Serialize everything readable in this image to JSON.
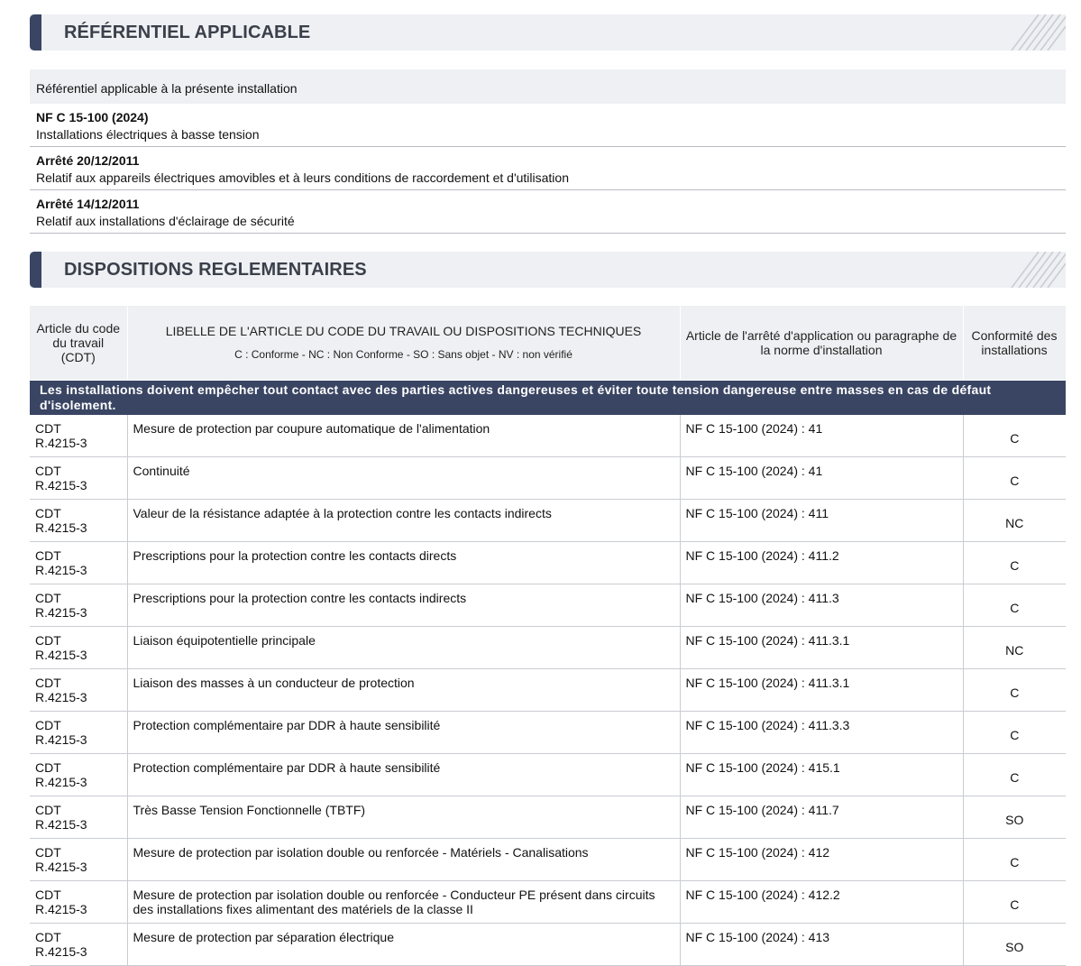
{
  "sections": {
    "referentiel_title": "RÉFÉRENTIEL APPLICABLE",
    "dispositions_title": "DISPOSITIONS REGLEMENTAIRES"
  },
  "referentiel": {
    "intro": "Référentiel applicable à la présente installation",
    "items": [
      {
        "title": "NF C 15-100 (2024)",
        "desc": "Installations électriques à basse tension"
      },
      {
        "title": "Arrêté 20/12/2011",
        "desc": "Relatif aux appareils électriques amovibles et à leurs conditions de raccordement et d'utilisation"
      },
      {
        "title": "Arrêté 14/12/2011",
        "desc": "Relatif aux installations d'éclairage de sécurité"
      }
    ]
  },
  "table": {
    "headers": {
      "article": "Article du code du travail (CDT)",
      "libelle": "LIBELLE DE L'ARTICLE DU CODE DU TRAVAIL OU DISPOSITIONS TECHNIQUES",
      "legend": "C : Conforme - NC : Non Conforme - SO : Sans objet - NV : non vérifié",
      "arrete": "Article de l'arrêté d'application ou paragraphe de la norme d'installation",
      "conformite": "Conformité des installations"
    },
    "group_title": "Les installations doivent empêcher tout contact avec des parties actives dangereuses et éviter toute tension dangereuse entre masses en cas de défaut d'isolement.",
    "rows": [
      {
        "cdt1": "CDT",
        "cdt2": "R.4215-3",
        "libelle": "Mesure de protection par coupure automatique de l'alimentation",
        "norme": "NF C 15-100 (2024) : 41",
        "conf": "C"
      },
      {
        "cdt1": "CDT",
        "cdt2": "R.4215-3",
        "libelle": "Continuité",
        "norme": "NF C 15-100 (2024) : 41",
        "conf": "C"
      },
      {
        "cdt1": "CDT",
        "cdt2": "R.4215-3",
        "libelle": "Valeur de la résistance adaptée à la protection contre les contacts indirects",
        "norme": "NF C 15-100 (2024) : 411",
        "conf": "NC"
      },
      {
        "cdt1": "CDT",
        "cdt2": "R.4215-3",
        "libelle": "Prescriptions pour la protection contre les contacts directs",
        "norme": "NF C 15-100 (2024) : 411.2",
        "conf": "C"
      },
      {
        "cdt1": "CDT",
        "cdt2": "R.4215-3",
        "libelle": "Prescriptions pour la protection contre les contacts indirects",
        "norme": "NF C 15-100 (2024) : 411.3",
        "conf": "C"
      },
      {
        "cdt1": "CDT",
        "cdt2": "R.4215-3",
        "libelle": "Liaison équipotentielle principale",
        "norme": "NF C 15-100 (2024) : 411.3.1",
        "conf": "NC"
      },
      {
        "cdt1": "CDT",
        "cdt2": "R.4215-3",
        "libelle": "Liaison des masses à un conducteur de protection",
        "norme": "NF C 15-100 (2024) : 411.3.1",
        "conf": "C"
      },
      {
        "cdt1": "CDT",
        "cdt2": "R.4215-3",
        "libelle": "Protection complémentaire par DDR à haute sensibilité",
        "norme": "NF C 15-100 (2024) : 411.3.3",
        "conf": "C"
      },
      {
        "cdt1": "CDT",
        "cdt2": "R.4215-3",
        "libelle": "Protection complémentaire par DDR à haute sensibilité",
        "norme": "NF C 15-100 (2024) : 415.1",
        "conf": "C"
      },
      {
        "cdt1": "CDT",
        "cdt2": "R.4215-3",
        "libelle": "Très Basse Tension Fonctionnelle (TBTF)",
        "norme": "NF C 15-100 (2024) : 411.7",
        "conf": "SO"
      },
      {
        "cdt1": "CDT",
        "cdt2": "R.4215-3",
        "libelle": "Mesure de protection par isolation double ou renforcée - Matériels - Canalisations",
        "norme": "NF C 15-100 (2024) : 412",
        "conf": "C"
      },
      {
        "cdt1": "CDT",
        "cdt2": "R.4215-3",
        "libelle": "Mesure de protection par isolation double ou renforcée - Conducteur PE présent dans circuits des installations fixes alimentant des matériels de la classe II",
        "norme": "NF C 15-100 (2024) : 412.2",
        "conf": "C"
      },
      {
        "cdt1": "CDT",
        "cdt2": "R.4215-3",
        "libelle": "Mesure de protection par séparation électrique",
        "norme": "NF C 15-100 (2024) : 413",
        "conf": "SO"
      }
    ]
  }
}
